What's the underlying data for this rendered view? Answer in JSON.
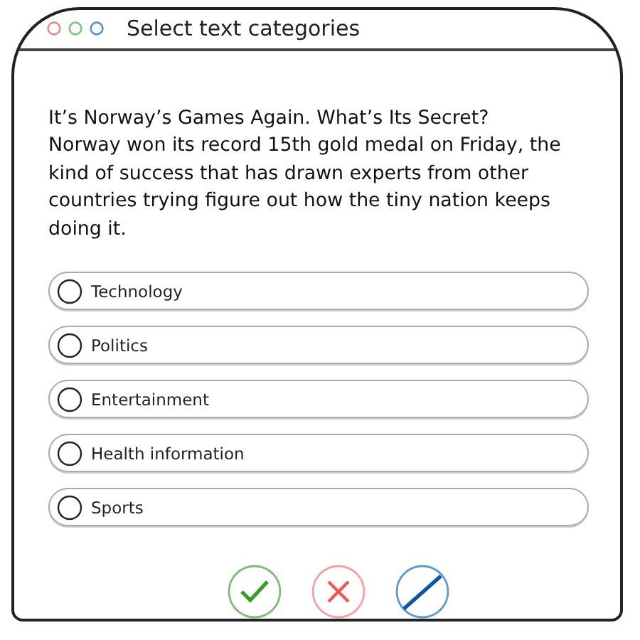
{
  "window": {
    "title": "Select text categories"
  },
  "article": {
    "headline": "It’s Norway’s Games Again. What’s Its Secret?",
    "body": "Norway won its record 15th gold medal on Friday, the kind of success that has drawn experts from other countries trying figure out how the tiny nation keeps doing it."
  },
  "options": [
    {
      "label": "Technology",
      "selected": false
    },
    {
      "label": "Politics",
      "selected": false
    },
    {
      "label": "Entertainment",
      "selected": false
    },
    {
      "label": "Health information",
      "selected": false
    },
    {
      "label": "Sports",
      "selected": false
    }
  ],
  "actions": [
    {
      "kind": "confirm"
    },
    {
      "kind": "cancel"
    },
    {
      "kind": "clear"
    }
  ]
}
